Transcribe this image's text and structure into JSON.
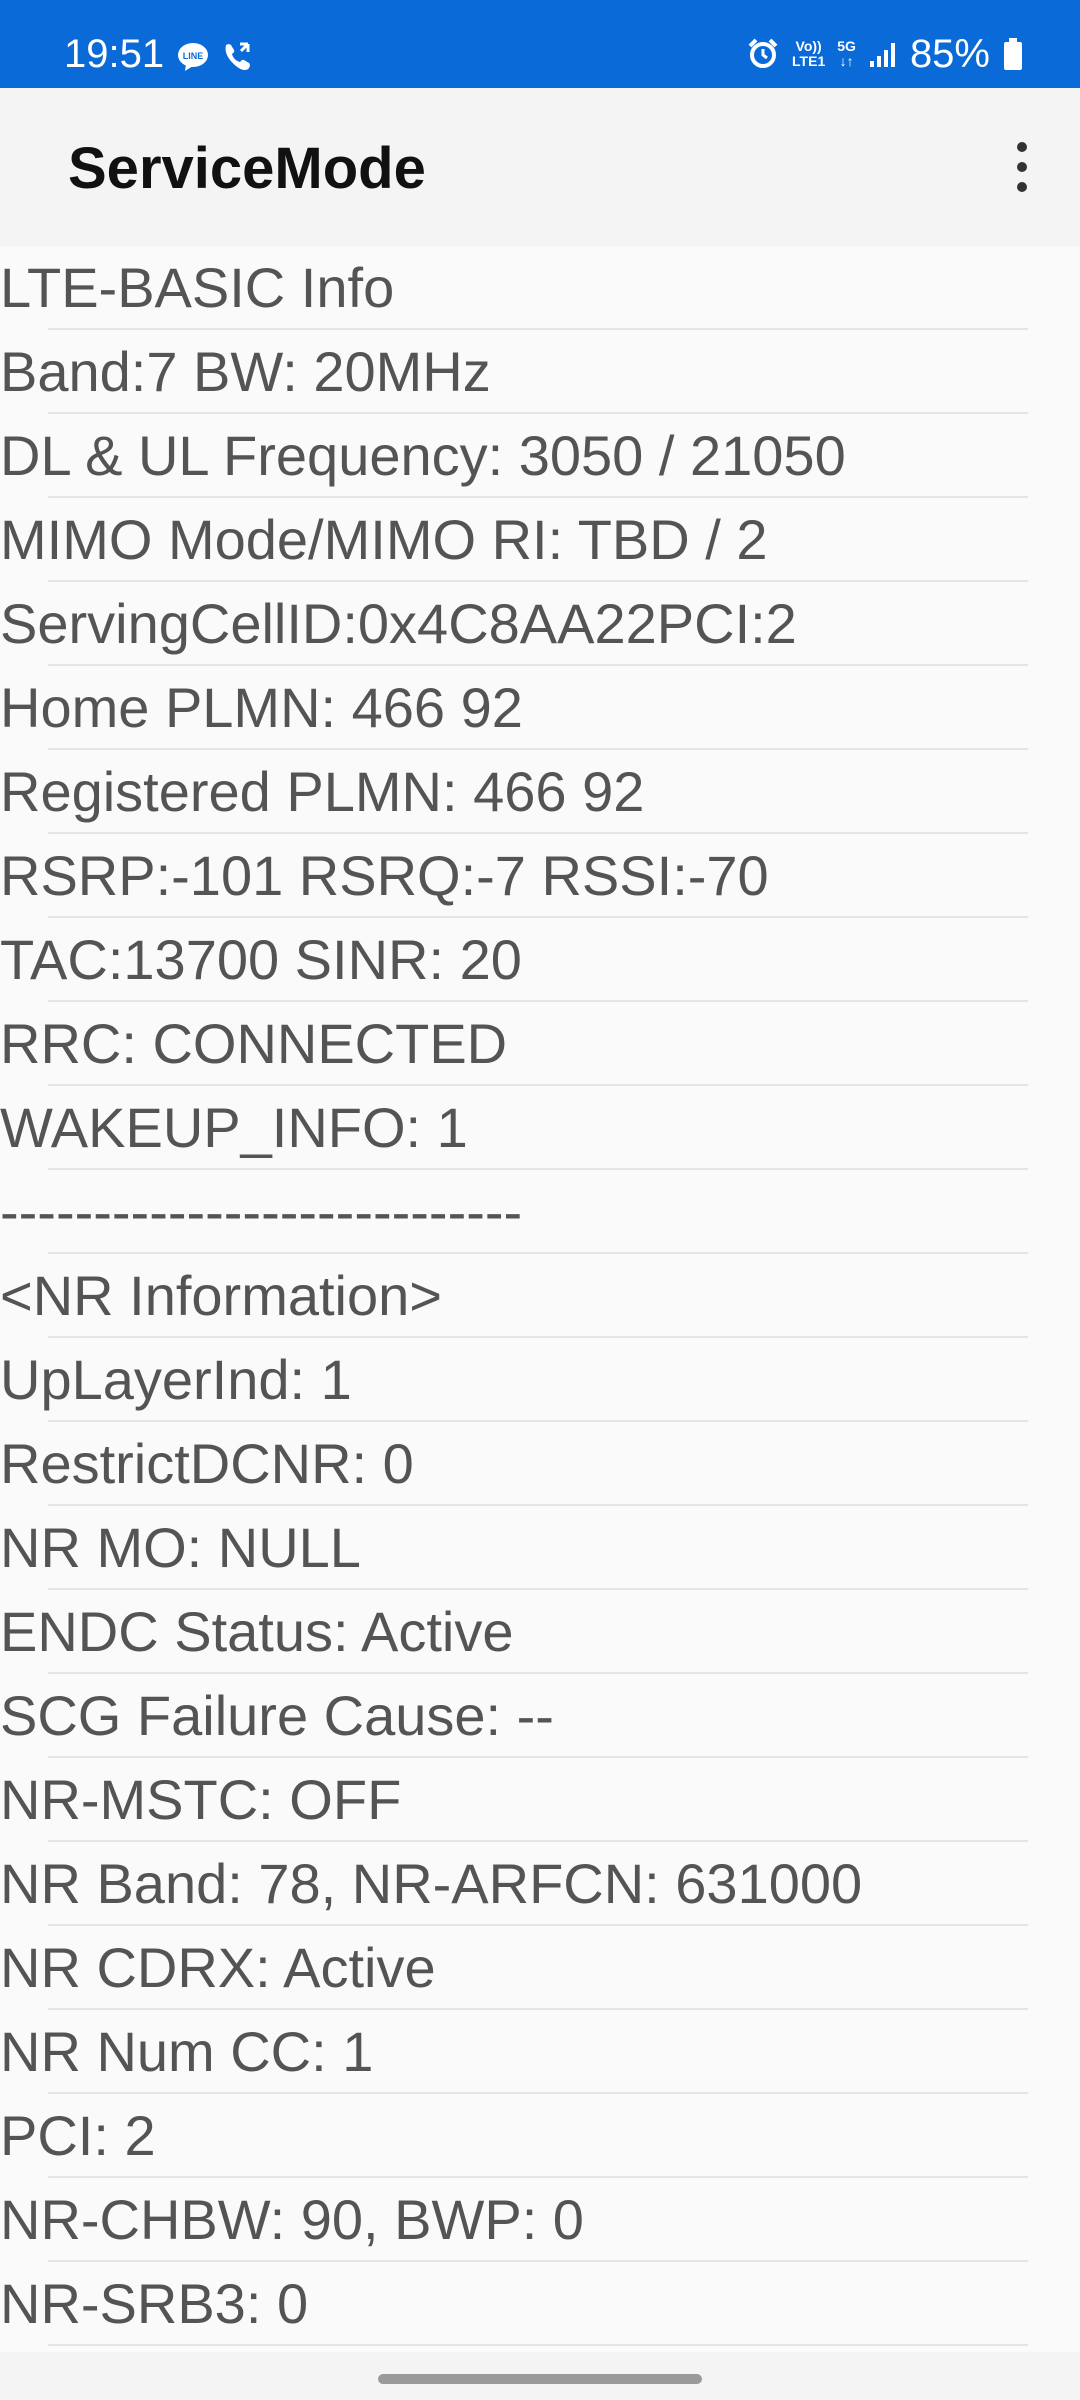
{
  "status_bar": {
    "time": "19:51",
    "battery": "85%",
    "volte_line1": "Vo))",
    "volte_line2": "LTE1",
    "network_type": "5G",
    "background_color": "#0a6ad8",
    "icons": [
      "line-app-icon",
      "call-icon",
      "alarm-icon",
      "volte-icon",
      "5g-icon",
      "signal-icon",
      "battery-icon"
    ]
  },
  "app_bar": {
    "title": "ServiceMode",
    "menu_icon": "more-vert-icon"
  },
  "rows": [
    "LTE-BASIC Info",
    "Band:7 BW: 20MHz",
    "DL & UL Frequency: 3050 / 21050",
    "MIMO Mode/MIMO RI: TBD / 2",
    "ServingCellID:0x4C8AA22PCI:2",
    "Home PLMN: 466 92",
    "Registered PLMN: 466 92",
    "RSRP:-101 RSRQ:-7 RSSI:-70",
    "TAC:13700 SINR: 20",
    "RRC: CONNECTED",
    "WAKEUP_INFO: 1",
    "----------------------------",
    "<NR Information>",
    "UpLayerInd: 1",
    "RestrictDCNR: 0",
    "NR MO: NULL",
    "ENDC Status: Active",
    "SCG Failure Cause: --",
    "NR-MSTC: OFF",
    "NR Band: 78, NR-ARFCN: 631000",
    "NR CDRX: Active",
    "NR Num CC: 1",
    "PCI: 2",
    "NR-CHBW: 90, BWP: 0",
    "NR-SRB3: 0"
  ]
}
